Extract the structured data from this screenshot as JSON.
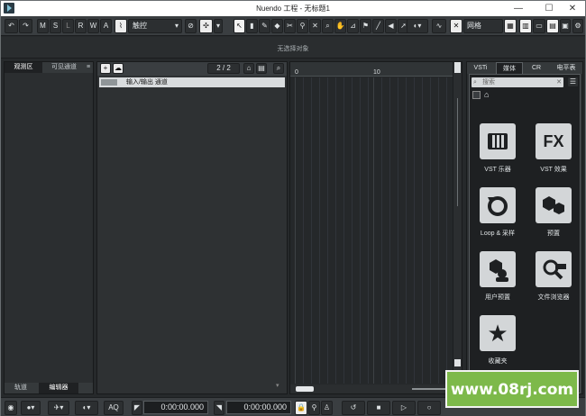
{
  "window": {
    "title": "Nuendo 工程 - 无标题1",
    "controls": [
      "—",
      "☐",
      "✕"
    ]
  },
  "toolbar": {
    "undo_icon": "undo-icon",
    "redo_icon": "redo-icon",
    "m_label": "M",
    "s_label": "S",
    "l_label": "L",
    "r_label": "R",
    "w_label": "W",
    "a_label": "A",
    "automation_mode": "触控",
    "grid_label": "网格"
  },
  "info_line": {
    "text": "无选择对象"
  },
  "left_zone": {
    "tabs": [
      "观测区",
      "可见通道"
    ],
    "bottom_tabs": [
      "轨道",
      "编辑器"
    ]
  },
  "tracks": {
    "counter": "2 / 2",
    "rows": [
      {
        "name": "输入/输出 通道"
      }
    ]
  },
  "ruler": {
    "marks": [
      "0",
      "10"
    ]
  },
  "right_zone": {
    "tabs": [
      "VSTi",
      "媒体",
      "CR",
      "电平表"
    ],
    "active_tab": "媒体",
    "search_placeholder": "搜索",
    "items": [
      {
        "label": "VST 乐器",
        "icon": "piano-keys-icon",
        "glyph": "▮▮▮"
      },
      {
        "label": "VST 效果",
        "icon": "fx-icon",
        "glyph": "FX"
      },
      {
        "label": "Loop & 采样",
        "icon": "loop-icon",
        "glyph": "↻"
      },
      {
        "label": "预置",
        "icon": "presets-icon",
        "glyph": "⬢"
      },
      {
        "label": "用户预置",
        "icon": "user-presets-icon",
        "glyph": "⬢"
      },
      {
        "label": "文件浏览器",
        "icon": "file-browser-icon",
        "glyph": "🔍"
      },
      {
        "label": "收藏夹",
        "icon": "favorites-icon",
        "glyph": "★"
      }
    ]
  },
  "transport": {
    "left_locator": "0:00:00.000",
    "right_locator": "0:00:00.000",
    "aq_label": "AQ"
  },
  "watermark": {
    "text": "www.08rj.com"
  },
  "colors": {
    "background": "#26292b",
    "accent_light": "#d3d6d8",
    "watermark_green": "#7db94a"
  }
}
